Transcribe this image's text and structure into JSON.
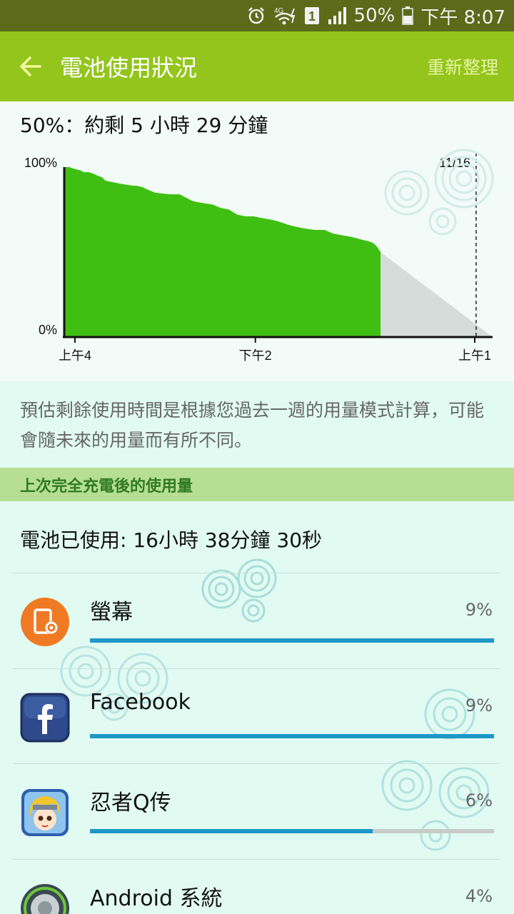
{
  "status_bar": {
    "network": "4G",
    "sim": "1",
    "battery_percent": "50%",
    "time": "下午 8:07"
  },
  "app_bar": {
    "title": "電池使用狀況",
    "refresh_label": "重新整理"
  },
  "estimate": {
    "headline": "50%：約剩 5 小時 29 分鐘"
  },
  "chart_data": {
    "type": "area",
    "ylabels": [
      "100%",
      "0%"
    ],
    "xlabels": [
      "上午4",
      "下午2",
      "上午1"
    ],
    "marker_label": "11/16",
    "used_color": "#3fbf12",
    "predicted_color": "#d6dcd9",
    "ylim": [
      0,
      100
    ],
    "series": [
      {
        "values": [
          [
            0,
            100
          ],
          [
            0.3,
            100
          ],
          [
            0.6,
            99
          ],
          [
            1.0,
            98
          ],
          [
            1.2,
            97
          ],
          [
            1.5,
            97
          ],
          [
            1.8,
            96
          ],
          [
            2.0,
            95
          ],
          [
            2.3,
            94
          ],
          [
            2.5,
            92
          ],
          [
            3.0,
            91
          ],
          [
            3.5,
            90
          ],
          [
            4.2,
            89
          ],
          [
            4.4,
            89
          ],
          [
            4.8,
            88
          ],
          [
            5.0,
            87
          ],
          [
            5.5,
            85
          ],
          [
            6.4,
            84
          ],
          [
            7.0,
            84
          ],
          [
            7.4,
            82
          ],
          [
            7.8,
            80
          ],
          [
            8.3,
            79
          ],
          [
            9.0,
            78
          ],
          [
            9.5,
            76
          ],
          [
            10.0,
            75
          ],
          [
            10.5,
            72
          ],
          [
            11.0,
            71
          ],
          [
            11.5,
            71
          ],
          [
            12.0,
            70
          ],
          [
            12.6,
            69
          ],
          [
            13.0,
            68
          ],
          [
            13.6,
            66
          ],
          [
            14.0,
            65
          ],
          [
            14.5,
            64
          ],
          [
            15.2,
            63
          ],
          [
            15.8,
            63
          ],
          [
            16.3,
            61
          ],
          [
            16.8,
            60
          ],
          [
            17.4,
            59
          ],
          [
            17.8,
            58
          ],
          [
            18.2,
            57
          ],
          [
            18.6,
            56
          ],
          [
            18.8,
            55
          ],
          [
            19.0,
            53
          ],
          [
            19.2,
            50
          ]
        ]
      },
      {
        "values": [
          [
            19.2,
            50
          ],
          [
            26.0,
            0
          ]
        ]
      }
    ],
    "x_range": [
      0,
      26
    ],
    "marker_x": 25.0
  },
  "note": "預估剩餘使用時間是根據您過去一週的用量模式計算，可能會隨未來的用量而有所不同。",
  "section_header": "上次完全充電後的使用量",
  "usage_total": "電池已使用: 16小時 38分鐘 30秒",
  "apps": [
    {
      "name": "螢幕",
      "percent_label": "9%",
      "bar_fraction": 1.0,
      "icon": "screen-settings-icon"
    },
    {
      "name": "Facebook",
      "percent_label": "9%",
      "bar_fraction": 1.0,
      "icon": "facebook-icon"
    },
    {
      "name": "忍者Q传",
      "percent_label": "6%",
      "bar_fraction": 0.7,
      "icon": "ninja-game-icon"
    },
    {
      "name": "Android 系統",
      "percent_label": "4%",
      "bar_fraction": 0.45,
      "icon": "android-system-icon"
    }
  ]
}
